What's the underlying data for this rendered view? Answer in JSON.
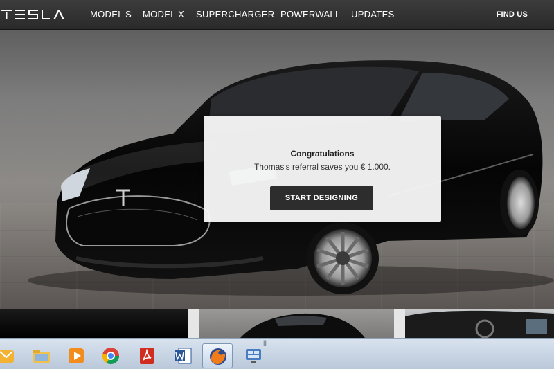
{
  "nav": {
    "logo_text": "TESLA",
    "links": [
      "MODEL S",
      "MODEL X",
      "SUPERCHARGER",
      "POWERWALL",
      "UPDATES"
    ],
    "right_link": "FIND US"
  },
  "modal": {
    "title": "Congratulations",
    "message": "Thomas's referral saves you € 1.000.",
    "button_label": "START DESIGNING"
  },
  "taskbar": {
    "grip": "|||",
    "apps": [
      "outlook-icon",
      "file-explorer-icon",
      "media-player-icon",
      "chrome-icon",
      "acrobat-icon",
      "word-icon",
      "firefox-icon",
      "remote-desktop-icon"
    ],
    "active_app": "firefox-icon"
  },
  "colors": {
    "nav_bg": "#333333",
    "button_bg": "#2d2d2d",
    "modal_bg": "#f6f6f6"
  }
}
